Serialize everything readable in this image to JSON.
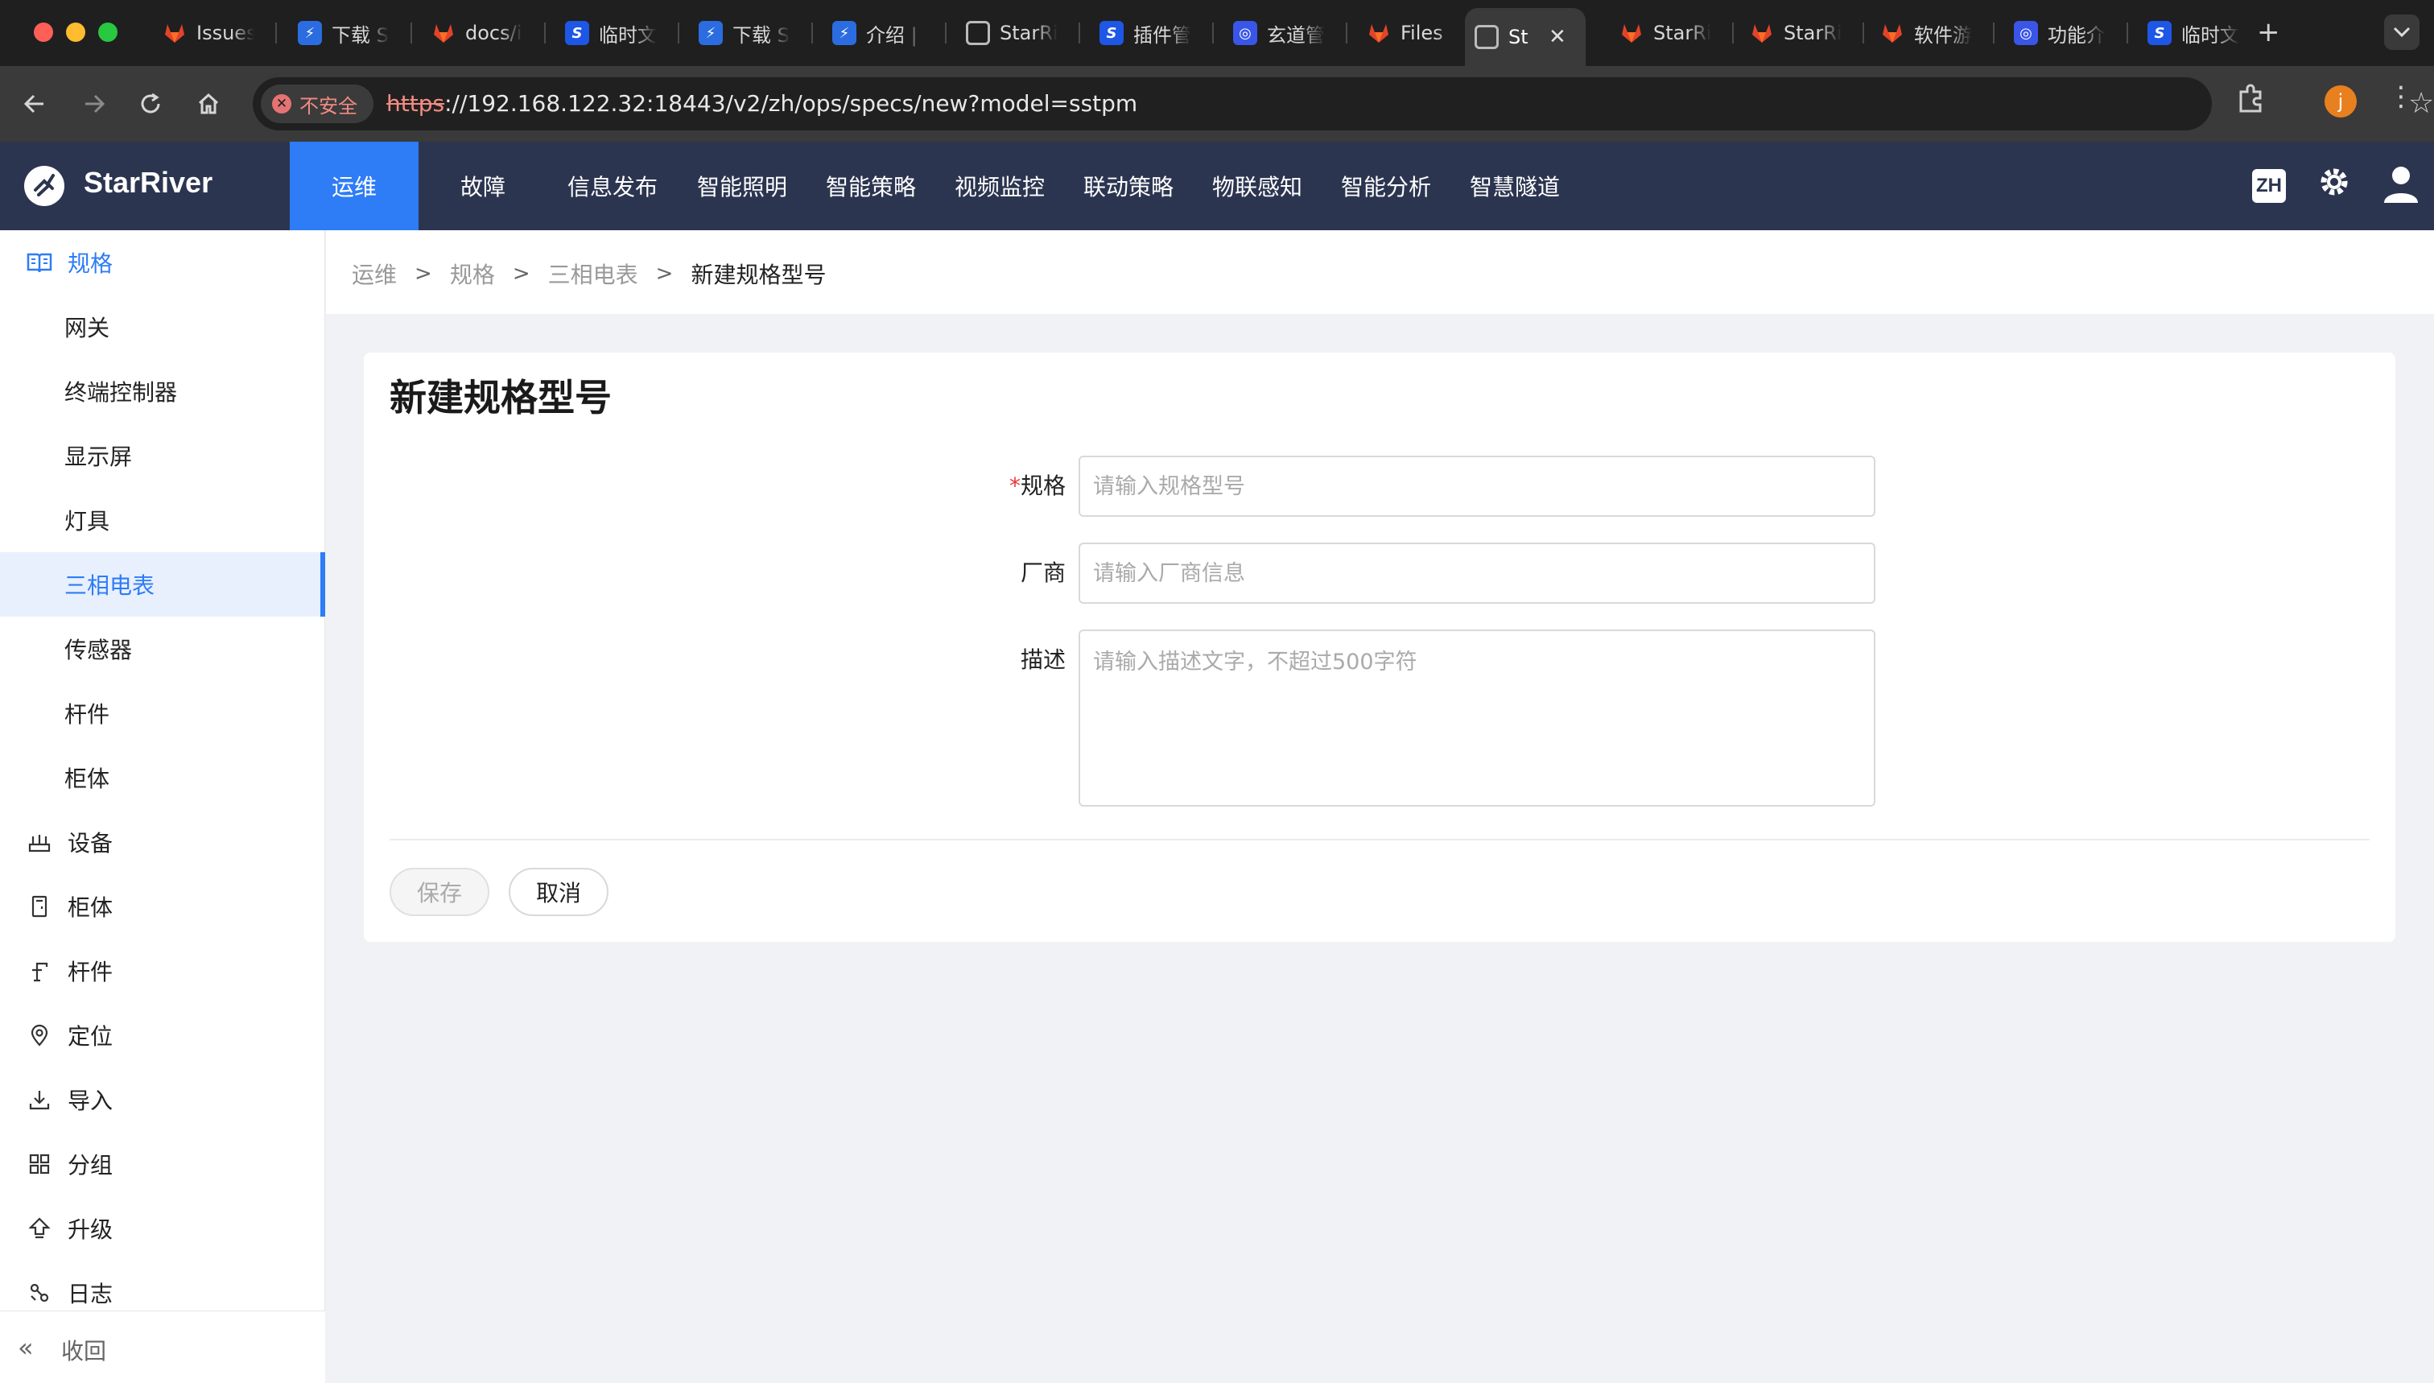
{
  "browser": {
    "tabs": [
      {
        "title": "Issues",
        "icon": "gitlab-icon"
      },
      {
        "title": "下载 S",
        "icon": "blue-app-icon"
      },
      {
        "title": "docs/i",
        "icon": "gitlab-icon"
      },
      {
        "title": "临时文",
        "icon": "s-doc-icon"
      },
      {
        "title": "下载 S",
        "icon": "blue-app-icon"
      },
      {
        "title": "介绍 |",
        "icon": "blue-app-icon"
      },
      {
        "title": "StarRi",
        "icon": "globe-icon"
      },
      {
        "title": "插件管",
        "icon": "s-doc-icon"
      },
      {
        "title": "玄道管",
        "icon": "circle-app-icon"
      },
      {
        "title": "Files",
        "icon": "gitlab-icon"
      },
      {
        "title": "St",
        "icon": "globe-icon",
        "active": true
      },
      {
        "title": "StarRi",
        "icon": "gitlab-icon"
      },
      {
        "title": "StarRi",
        "icon": "gitlab-icon"
      },
      {
        "title": "软件游",
        "icon": "gitlab-icon"
      },
      {
        "title": "功能介",
        "icon": "circle-app-icon"
      },
      {
        "title": "临时文",
        "icon": "s-doc-icon"
      }
    ],
    "close_glyph": "✕",
    "new_tab_glyph": "+",
    "security_label": "不安全",
    "url_protocol": "https",
    "url_rest": "://192.168.122.32:18443/v2/zh/ops/specs/new?model=sstpm",
    "profile_initial": "j"
  },
  "app": {
    "brand": "StarRiver",
    "nav": [
      "运维",
      "故障",
      "信息发布",
      "智能照明",
      "智能策略",
      "视频监控",
      "联动策略",
      "物联感知",
      "智能分析",
      "智慧隧道"
    ],
    "active_nav": "运维",
    "lang": "ZH"
  },
  "sidebar": {
    "group_title": "规格",
    "sub_items": [
      "网关",
      "终端控制器",
      "显示屏",
      "灯具",
      "三相电表",
      "传感器",
      "杆件",
      "柜体"
    ],
    "selected_sub": "三相电表",
    "items": [
      {
        "label": "设备",
        "icon": "device-icon"
      },
      {
        "label": "柜体",
        "icon": "cabinet-icon"
      },
      {
        "label": "杆件",
        "icon": "pole-icon"
      },
      {
        "label": "定位",
        "icon": "location-icon"
      },
      {
        "label": "导入",
        "icon": "import-icon"
      },
      {
        "label": "分组",
        "icon": "grid-icon"
      },
      {
        "label": "升级",
        "icon": "upgrade-icon"
      },
      {
        "label": "日志",
        "icon": "log-icon"
      }
    ],
    "collapse_label": "收回"
  },
  "breadcrumb": [
    "运维",
    "规格",
    "三相电表",
    "新建规格型号"
  ],
  "form": {
    "title": "新建规格型号",
    "spec_label": "规格",
    "spec_required_mark": "*",
    "spec_placeholder": "请输入规格型号",
    "vendor_label": "厂商",
    "vendor_placeholder": "请输入厂商信息",
    "desc_label": "描述",
    "desc_placeholder": "请输入描述文字，不超过500字符",
    "save_label": "保存",
    "cancel_label": "取消"
  },
  "colors": {
    "header_bg": "#2c3550",
    "accent": "#2e7cf6",
    "required": "#e53935"
  }
}
